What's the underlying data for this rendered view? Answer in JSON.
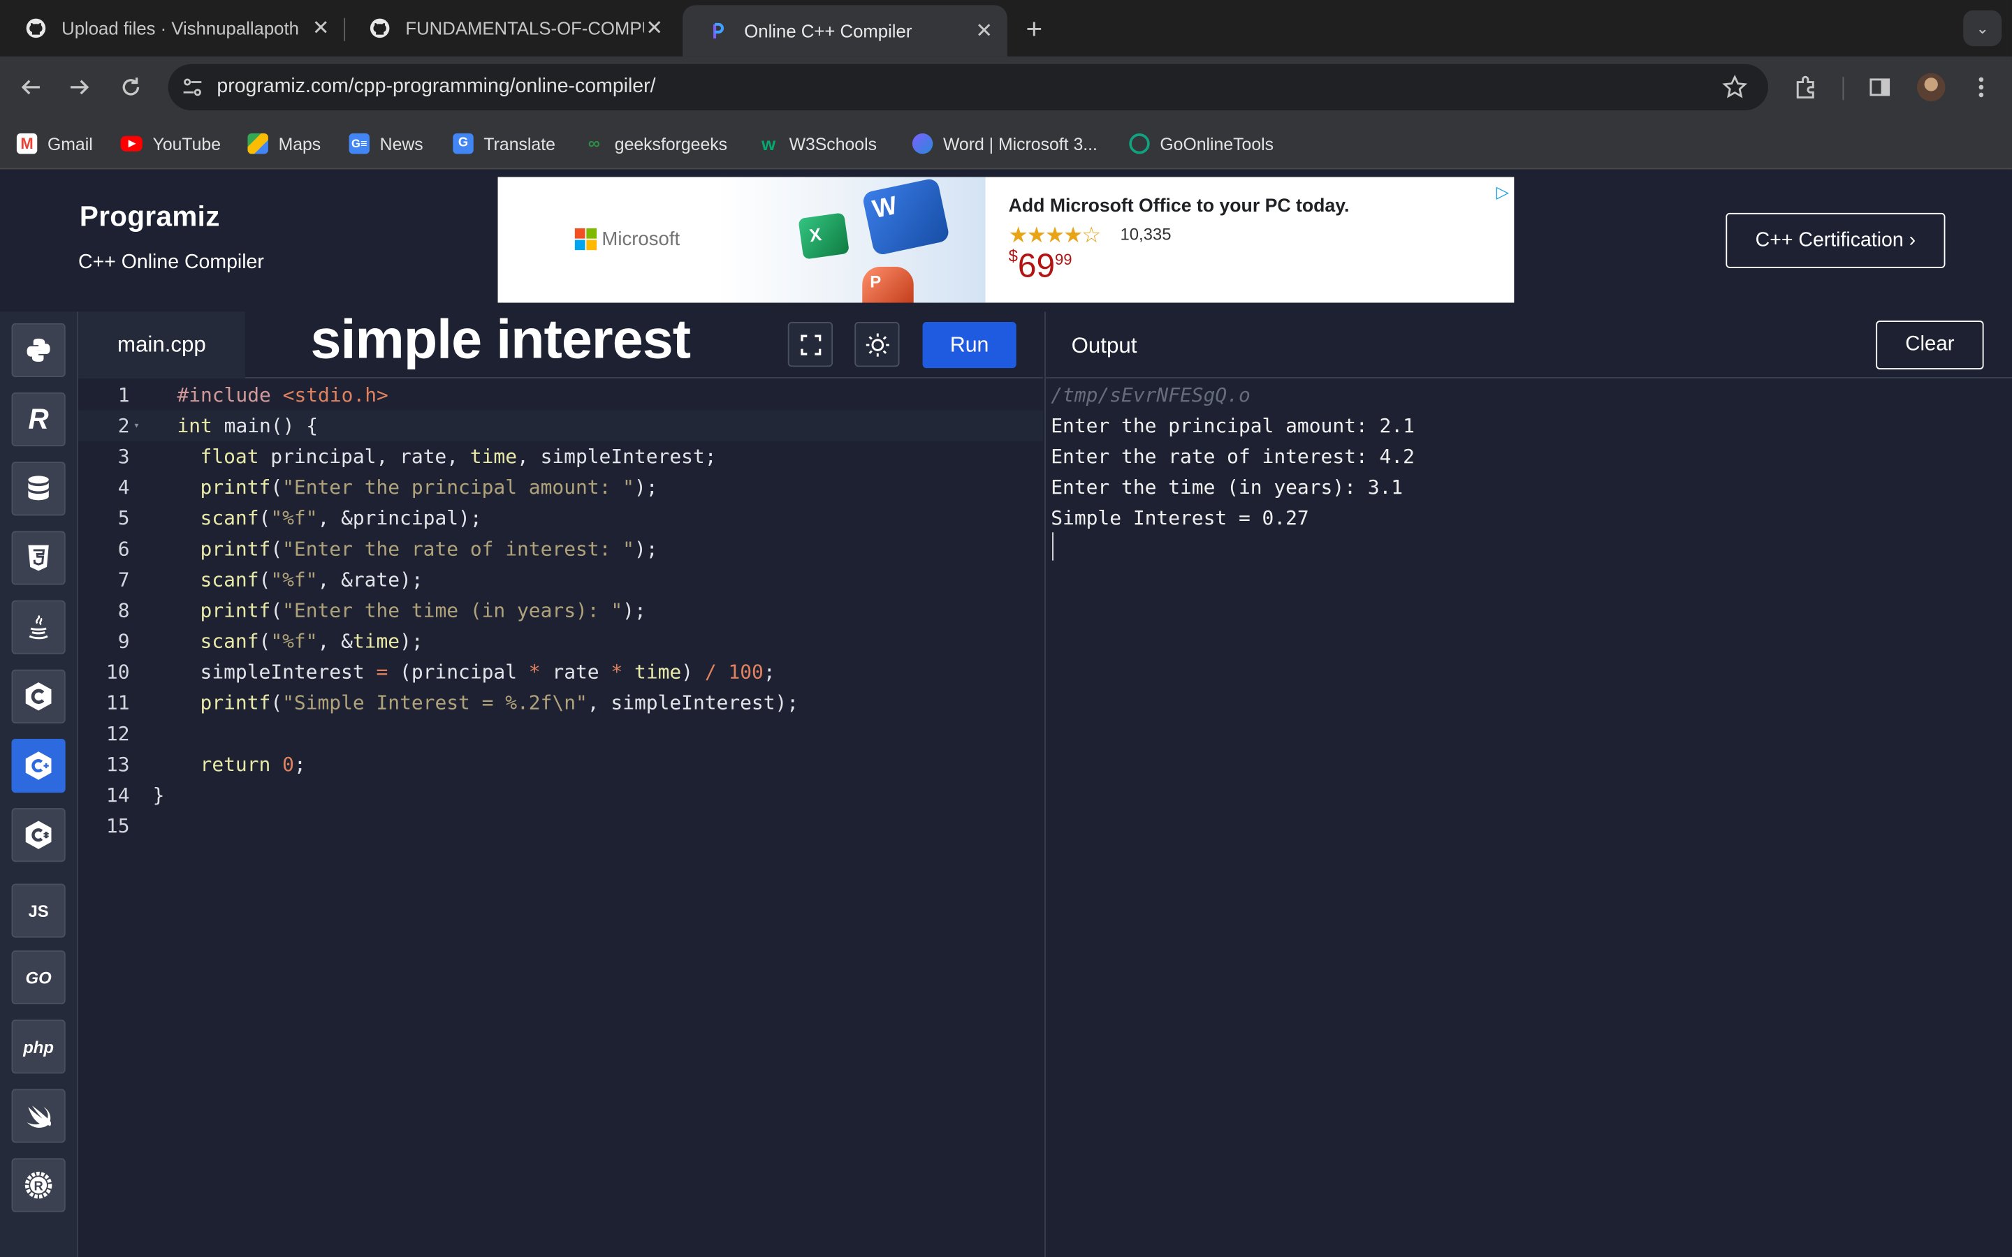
{
  "browser": {
    "tabs": [
      {
        "title": "Upload files · Vishnupallapoth",
        "icon": "github-icon"
      },
      {
        "title": "FUNDAMENTALS-OF-COMPU",
        "icon": "github-icon"
      },
      {
        "title": "Online C++ Compiler",
        "icon": "programiz-icon",
        "active": true
      }
    ],
    "new_tab": "+",
    "url": "programiz.com/cpp-programming/online-compiler/",
    "bookmarks": [
      {
        "label": "Gmail",
        "color": "#ea4335"
      },
      {
        "label": "YouTube",
        "color": "#ff0000"
      },
      {
        "label": "Maps",
        "color": "#34a853"
      },
      {
        "label": "News",
        "color": "#4285f4"
      },
      {
        "label": "Translate",
        "color": "#4285f4"
      },
      {
        "label": "geeksforgeeks",
        "color": "#2f8d46"
      },
      {
        "label": "W3Schools",
        "color": "#04aa6d"
      },
      {
        "label": "Word | Microsoft 3...",
        "color": "#7b61ff"
      },
      {
        "label": "GoOnlineTools",
        "color": "#10a37f"
      }
    ]
  },
  "header": {
    "logo": "Programiz",
    "subtitle": "C++ Online Compiler",
    "certification_button": "C++ Certification ›"
  },
  "ad": {
    "brand": "Microsoft",
    "headline": "Add Microsoft Office to your PC today.",
    "stars": "★★★★☆",
    "rating_count": "10,335",
    "price_currency": "$",
    "price_whole": "69",
    "price_cents": "99"
  },
  "sidebar": {
    "languages": [
      "python",
      "r",
      "sql",
      "html",
      "java",
      "c",
      "cpp",
      "csharp",
      "JS",
      "GO",
      "php",
      "swift",
      "rust"
    ],
    "selected": "cpp"
  },
  "editor": {
    "filename": "main.cpp",
    "overlay_title": "simple interest",
    "run_label": "Run",
    "lines": [
      "#include <stdio.h>",
      "int main() {",
      "  float principal, rate, time, simpleInterest;",
      "  printf(\"Enter the principal amount: \");",
      "  scanf(\"%f\", &principal);",
      "  printf(\"Enter the rate of interest: \");",
      "  scanf(\"%f\", &rate);",
      "  printf(\"Enter the time (in years): \");",
      "  scanf(\"%f\", &time);",
      "  simpleInterest = (principal * rate * time) / 100;",
      "  printf(\"Simple Interest = %.2f\\n\", simpleInterest);",
      "",
      "  return 0;",
      "}",
      ""
    ],
    "active_line": 2
  },
  "output": {
    "label": "Output",
    "clear_label": "Clear",
    "path": "/tmp/sEvrNFESgQ.o",
    "lines": [
      "Enter the principal amount: 2.1",
      "Enter the rate of interest: 4.2",
      "Enter the time (in years): 3.1",
      "Simple Interest = 0.27"
    ]
  },
  "colors": {
    "keyword": "#e8e8a8",
    "string": "#b0a37b",
    "include_path": "#e0825f",
    "number": "#e0825f",
    "run_button": "#1f5be0",
    "selected_lang": "#2d6ae0"
  }
}
